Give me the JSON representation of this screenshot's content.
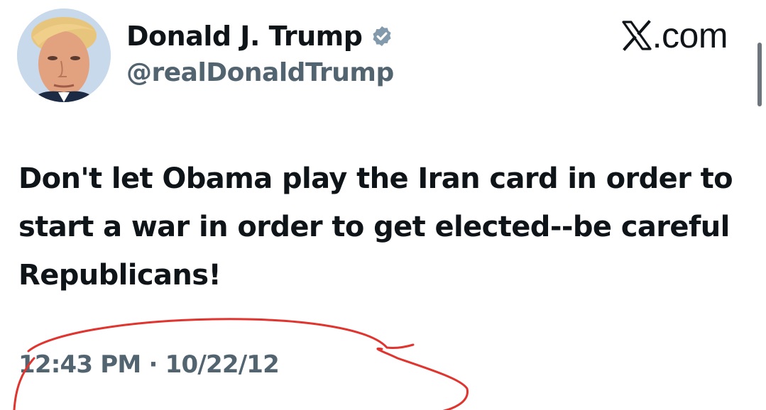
{
  "header": {
    "display_name": "Donald J. Trump",
    "handle": "@realDonaldTrump",
    "site_label": ".com",
    "verified_icon": "verified-badge-icon",
    "avatar_icon": "profile-photo"
  },
  "tweet": {
    "text": "Don't let Obama play the Iran card in order to start a war in order to get elected--be careful Republicans!",
    "time": "12:43 PM",
    "separator": "·",
    "date": "10/22/12"
  },
  "colors": {
    "text_primary": "#0f1419",
    "text_secondary": "#536471",
    "verified_badge": "#829aab",
    "annotation_ink": "#e0342f"
  }
}
